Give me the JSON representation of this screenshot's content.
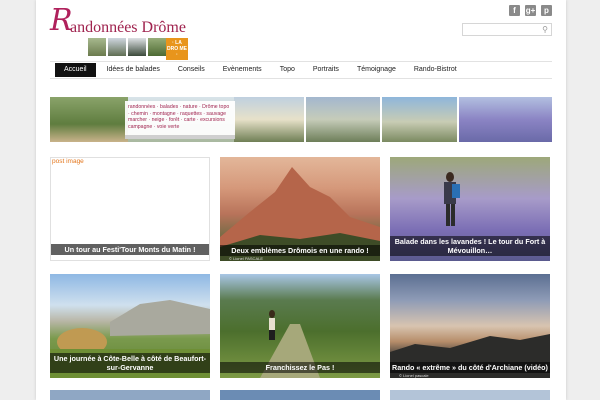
{
  "site": {
    "logo_initial": "R",
    "logo_text": "andonnées Drôme",
    "logo_badge": "· LA DRO ME ·"
  },
  "social": [
    "f",
    "g+",
    "p"
  ],
  "social_icons": [
    "facebook-icon",
    "google-plus-icon",
    "pinterest-icon"
  ],
  "search": {
    "placeholder": ""
  },
  "nav": {
    "items": [
      "Accueil",
      "Idées de balades",
      "Conseils",
      "Evènements",
      "Topo",
      "Portraits",
      "Témoignage",
      "Rando-Bistrot"
    ],
    "active": "Accueil"
  },
  "banner": {
    "tagline": "randonnées · balades · nature · Drôme topo · chemin · montagne · raquettes · sauvage marcher · neige · forêt · carte · excursions campagne · voie verte"
  },
  "posts": [
    {
      "title": "Un tour au Festi'Tour Monts du Matin !",
      "image_alt": "post image",
      "credit": ""
    },
    {
      "title": "Deux emblèmes Drômois en une rando !",
      "image_alt": "",
      "credit": "© Lionel PASCALE"
    },
    {
      "title": "Balade dans les lavandes ! Le tour du Fort à Mévouillon…",
      "image_alt": "",
      "credit": ""
    },
    {
      "title": "Une journée à Côte-Belle à côté de Beaufort-sur-Gervanne",
      "image_alt": "",
      "credit": ""
    },
    {
      "title": "Franchissez le Pas !",
      "image_alt": "",
      "credit": ""
    },
    {
      "title": "Rando « extrême » du côté d'Archiane (vidéo)",
      "image_alt": "",
      "credit": "© Lionel pascale"
    }
  ],
  "colors": {
    "brand": "#a0244f",
    "accent": "#e8951c",
    "nav_active_bg": "#111111"
  }
}
